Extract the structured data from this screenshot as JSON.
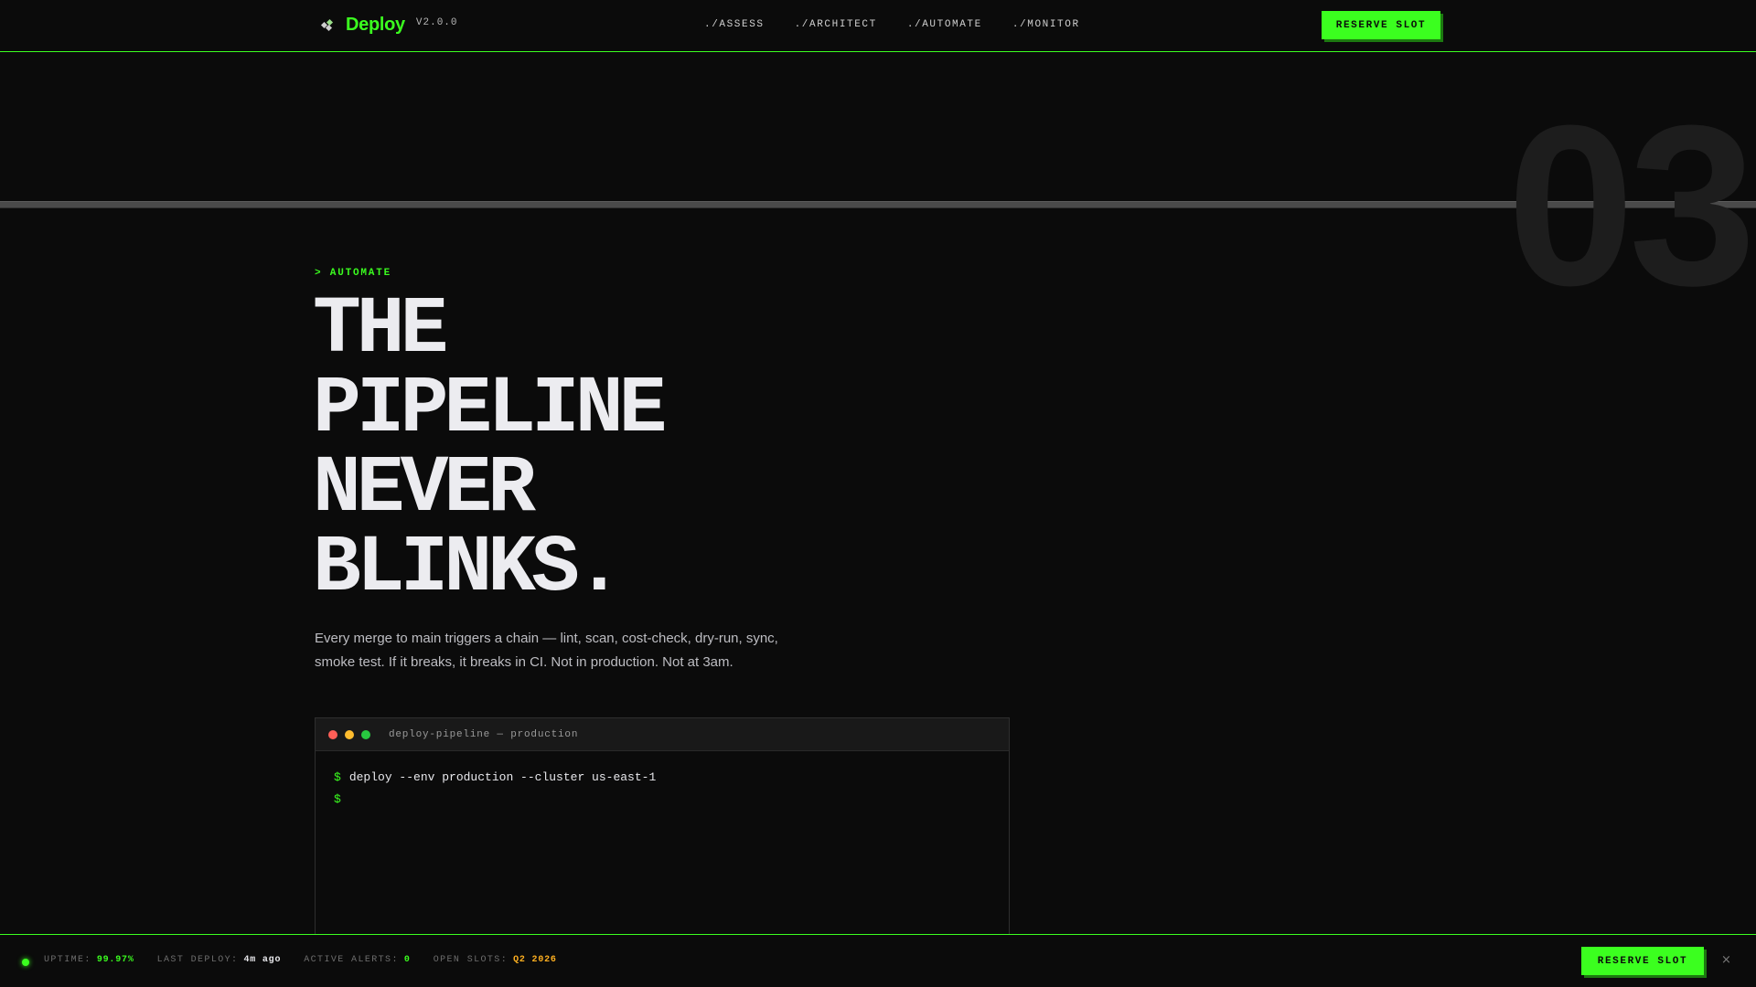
{
  "header": {
    "brand_name": "Deploy",
    "version": "V2.0.0",
    "nav": [
      {
        "label": "./ASSESS"
      },
      {
        "label": "./ARCHITECT"
      },
      {
        "label": "./AUTOMATE"
      },
      {
        "label": "./MONITOR"
      }
    ],
    "cta_label": "RESERVE SLOT"
  },
  "section_number": "03",
  "hero": {
    "eyebrow": "> AUTOMATE",
    "headline_lines": [
      "THE",
      "PIPELINE",
      "NEVER",
      "BLINKS."
    ],
    "lede": "Every merge to main triggers a chain — lint, scan, cost-check, dry-run, sync, smoke test. If it breaks, it breaks in CI. Not in production. Not at 3am."
  },
  "terminal": {
    "title": "deploy-pipeline — production",
    "lines": [
      {
        "prompt": "$",
        "command": "deploy --env production --cluster us-east-1"
      },
      {
        "prompt": "$",
        "command": ""
      }
    ]
  },
  "status_bar": {
    "stats": [
      {
        "label": "UPTIME:",
        "value": "99.97%"
      },
      {
        "label": "LAST DEPLOY:",
        "value": "4m ago"
      },
      {
        "label": "ACTIVE ALERTS:",
        "value": "0"
      },
      {
        "label": "OPEN SLOTS:",
        "value": "Q2 2026"
      }
    ],
    "cta_label": "RESERVE SLOT",
    "close_glyph": "×"
  },
  "colors": {
    "accent": "#3bff1f",
    "background": "#0b0b0b",
    "warning": "#ffb020"
  }
}
